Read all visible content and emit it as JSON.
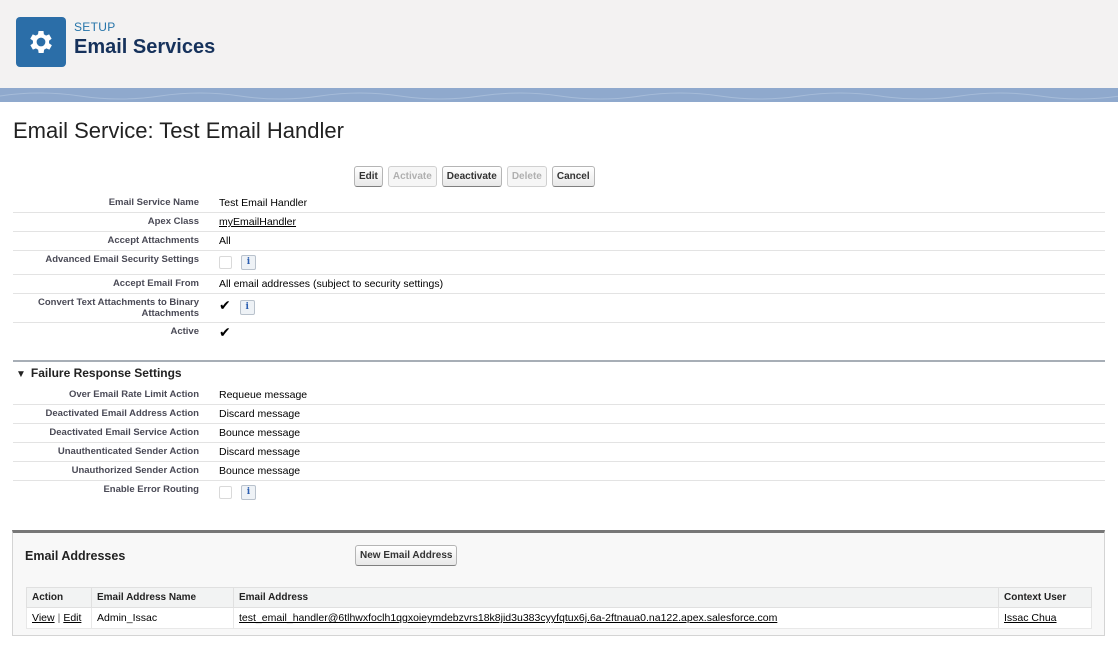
{
  "header": {
    "icon": "gear-icon",
    "setup_label": "SETUP",
    "title": "Email Services",
    "accent": "#2b6ea8"
  },
  "page": {
    "title": "Email Service: Test Email Handler"
  },
  "buttons": {
    "edit": "Edit",
    "activate": "Activate",
    "deactivate": "Deactivate",
    "delete": "Delete",
    "cancel": "Cancel"
  },
  "details": {
    "email_service_name_label": "Email Service Name",
    "email_service_name": "Test Email Handler",
    "apex_class_label": "Apex Class",
    "apex_class": "myEmailHandler",
    "accept_attachments_label": "Accept Attachments",
    "accept_attachments": "All",
    "advanced_security_label": "Advanced Email Security Settings",
    "accept_email_from_label": "Accept Email From",
    "accept_email_from": "All email addresses (subject to security settings)",
    "convert_text_label": "Convert Text Attachments to Binary Attachments",
    "active_label": "Active"
  },
  "failure": {
    "section_title": "Failure Response Settings",
    "over_rate_label": "Over Email Rate Limit Action",
    "over_rate": "Requeue message",
    "deactivated_address_label": "Deactivated Email Address Action",
    "deactivated_address": "Discard message",
    "deactivated_service_label": "Deactivated Email Service Action",
    "deactivated_service": "Bounce message",
    "unauthenticated_label": "Unauthenticated Sender Action",
    "unauthenticated": "Discard message",
    "unauthorized_label": "Unauthorized Sender Action",
    "unauthorized": "Bounce message",
    "error_routing_label": "Enable Error Routing"
  },
  "email_addresses": {
    "title": "Email Addresses",
    "new_button": "New Email Address",
    "columns": [
      "Action",
      "Email Address Name",
      "Email Address",
      "Context User"
    ],
    "rows": [
      {
        "view": "View",
        "separator": "|",
        "edit": "Edit",
        "name": "Admin_Issac",
        "address": "test_email_handler@6tlhwxfoclh1qgxoieymdebzvrs18k8jid3u383cyyfqtux6j.6a-2ftnaua0.na122.apex.salesforce.com",
        "context_user": "Issac Chua"
      }
    ]
  },
  "icons": {
    "info": "info-icon",
    "checkmark": "✔"
  }
}
